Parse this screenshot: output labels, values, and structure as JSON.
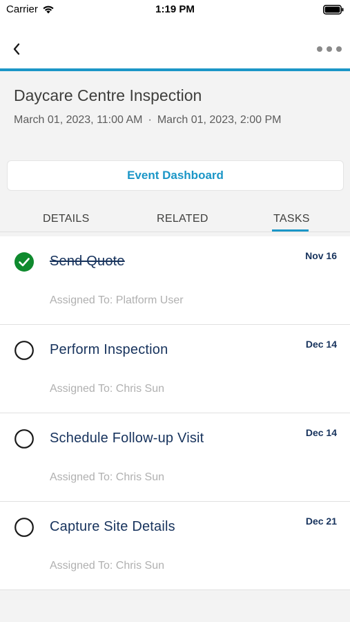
{
  "status_bar": {
    "carrier": "Carrier",
    "time": "1:19 PM"
  },
  "nav": {
    "back_icon": "chevron-left-icon",
    "more_icon": "more-horizontal-icon",
    "accent_color": "#1b96c7"
  },
  "record": {
    "title": "Daycare Centre Inspection",
    "start": "March 01, 2023, 11:00 AM",
    "separator": "·",
    "end": "March 01, 2023, 2:00 PM"
  },
  "dashboard_button": {
    "label": "Event Dashboard"
  },
  "tabs": [
    {
      "label": "DETAILS",
      "active": false
    },
    {
      "label": "RELATED",
      "active": false
    },
    {
      "label": "TASKS",
      "active": true
    }
  ],
  "tasks": [
    {
      "subject": "Send Quote",
      "date": "Nov 16",
      "assigned": "Assigned To: Platform User",
      "completed": true
    },
    {
      "subject": "Perform Inspection",
      "date": "Dec 14",
      "assigned": "Assigned To: Chris Sun",
      "completed": false
    },
    {
      "subject": "Schedule Follow-up Visit",
      "date": "Dec 14",
      "assigned": "Assigned To: Chris Sun",
      "completed": false
    },
    {
      "subject": "Capture Site Details",
      "date": "Dec 21",
      "assigned": "Assigned To: Chris Sun",
      "completed": false
    }
  ],
  "colors": {
    "complete_green": "#0f8a2e",
    "link_blue": "#1b96c7",
    "text_navy": "#16325c"
  }
}
